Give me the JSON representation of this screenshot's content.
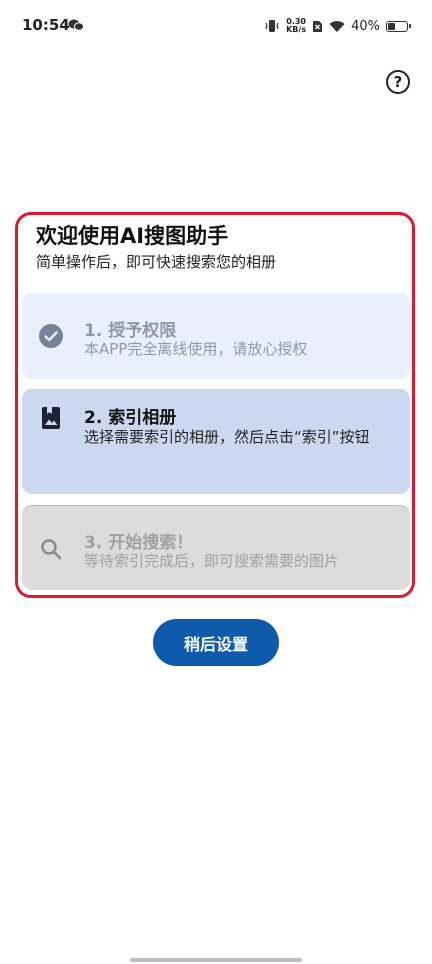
{
  "status_bar": {
    "time": "10:54",
    "net_speed_value": "0.30",
    "net_speed_unit": "KB/s",
    "battery": "40%",
    "battery_level": 0.4
  },
  "header": {
    "help_label": "?"
  },
  "welcome": {
    "title": "欢迎使用AI搜图助手",
    "subtitle": "简单操作后，即可快速搜索您的相册"
  },
  "steps": [
    {
      "title": "1. 授予权限",
      "description": "本APP完全离线使用，请放心授权",
      "icon": "check-circle-icon",
      "state": "done"
    },
    {
      "title": "2. 索引相册",
      "description": "选择需要索引的相册，然后点击“索引”按钮",
      "icon": "photo-album-icon",
      "state": "active"
    },
    {
      "title": "3. 开始搜索！",
      "description": "等待索引完成后，即可搜索需要的图片",
      "icon": "search-icon",
      "state": "pending"
    }
  ],
  "actions": {
    "later_label": "稍后设置"
  },
  "colors": {
    "highlight": "#e0182b",
    "primary": "#0f5bab",
    "step_done_bg": "#eaf0fb",
    "step_active_bg": "#cbd8ef",
    "step_pending_bg": "#dcdcdc"
  }
}
